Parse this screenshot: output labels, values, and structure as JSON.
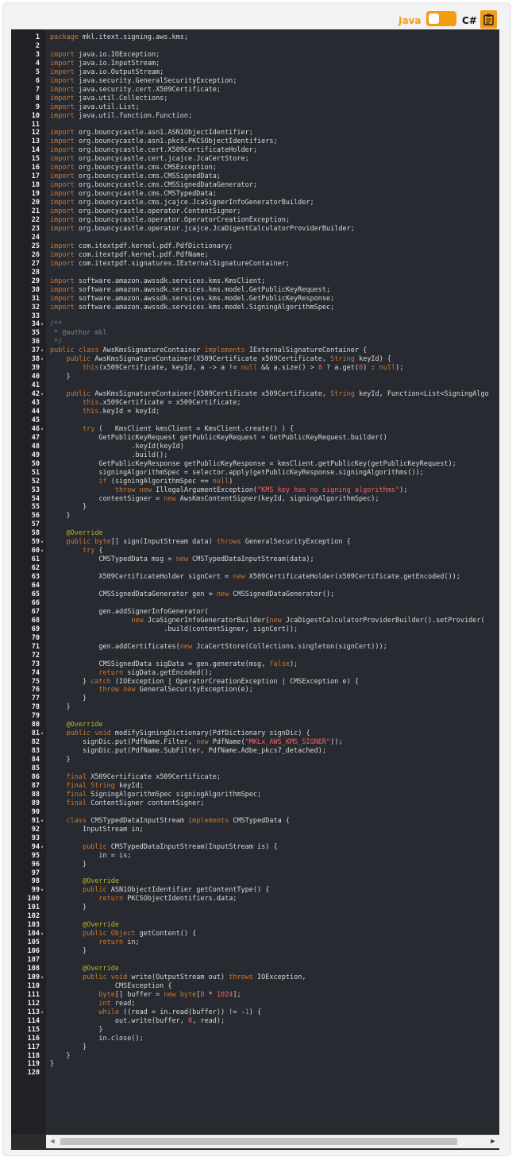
{
  "toolbar": {
    "java_label": "Java",
    "csharp_label": "C#",
    "copy_icon": "clipboard-icon",
    "toggle_state": "java",
    "accent": "#f39c12"
  },
  "code_lines": [
    "package mkl.itext.signing.aws.kms;",
    "",
    "import java.io.IOException;",
    "import java.io.InputStream;",
    "import java.io.OutputStream;",
    "import java.security.GeneralSecurityException;",
    "import java.security.cert.X509Certificate;",
    "import java.util.Collections;",
    "import java.util.List;",
    "import java.util.function.Function;",
    "",
    "import org.bouncycastle.asn1.ASN1ObjectIdentifier;",
    "import org.bouncycastle.asn1.pkcs.PKCSObjectIdentifiers;",
    "import org.bouncycastle.cert.X509CertificateHolder;",
    "import org.bouncycastle.cert.jcajce.JcaCertStore;",
    "import org.bouncycastle.cms.CMSException;",
    "import org.bouncycastle.cms.CMSSignedData;",
    "import org.bouncycastle.cms.CMSSignedDataGenerator;",
    "import org.bouncycastle.cms.CMSTypedData;",
    "import org.bouncycastle.cms.jcajce.JcaSignerInfoGeneratorBuilder;",
    "import org.bouncycastle.operator.ContentSigner;",
    "import org.bouncycastle.operator.OperatorCreationException;",
    "import org.bouncycastle.operator.jcajce.JcaDigestCalculatorProviderBuilder;",
    "",
    "import com.itextpdf.kernel.pdf.PdfDictionary;",
    "import com.itextpdf.kernel.pdf.PdfName;",
    "import com.itextpdf.signatures.IExternalSignatureContainer;",
    "",
    "import software.amazon.awssdk.services.kms.KmsClient;",
    "import software.amazon.awssdk.services.kms.model.GetPublicKeyRequest;",
    "import software.amazon.awssdk.services.kms.model.GetPublicKeyResponse;",
    "import software.amazon.awssdk.services.kms.model.SigningAlgorithmSpec;",
    "",
    "/**",
    " * @author mkl",
    " */",
    "public class AwsKmsSignatureContainer implements IExternalSignatureContainer {",
    "    public AwsKmsSignatureContainer(X509Certificate x509Certificate, String keyId) {",
    "        this(x509Certificate, keyId, a -> a != null && a.size() > 0 ? a.get(0) : null);",
    "    }",
    "",
    "    public AwsKmsSignatureContainer(X509Certificate x509Certificate, String keyId, Function<List<SigningAlgo",
    "        this.x509Certificate = x509Certificate;",
    "        this.keyId = keyId;",
    "",
    "        try (   KmsClient kmsClient = KmsClient.create() ) {",
    "            GetPublicKeyRequest getPublicKeyRequest = GetPublicKeyRequest.builder()",
    "                    .keyId(keyId)",
    "                    .build();",
    "            GetPublicKeyResponse getPublicKeyResponse = kmsClient.getPublicKey(getPublicKeyRequest);",
    "            signingAlgorithmSpec = selector.apply(getPublicKeyResponse.signingAlgorithms());",
    "            if (signingAlgorithmSpec == null)",
    "                throw new IllegalArgumentException(\"KMS key has no signing algorithms\");",
    "            contentSigner = new AwsKmsContentSigner(keyId, signingAlgorithmSpec);",
    "        }",
    "    }",
    "",
    "    @Override",
    "    public byte[] sign(InputStream data) throws GeneralSecurityException {",
    "        try {",
    "            CMSTypedData msg = new CMSTypedDataInputStream(data);",
    "",
    "            X509CertificateHolder signCert = new X509CertificateHolder(x509Certificate.getEncoded());",
    "",
    "            CMSSignedDataGenerator gen = new CMSSignedDataGenerator();",
    "",
    "            gen.addSignerInfoGenerator(",
    "                    new JcaSignerInfoGeneratorBuilder(new JcaDigestCalculatorProviderBuilder().setProvider(\"",
    "                            .build(contentSigner, signCert));",
    "",
    "            gen.addCertificates(new JcaCertStore(Collections.singleton(signCert)));",
    "",
    "            CMSSignedData sigData = gen.generate(msg, false);",
    "            return sigData.getEncoded();",
    "        } catch (IOException | OperatorCreationException | CMSException e) {",
    "            throw new GeneralSecurityException(e);",
    "        }",
    "    }",
    "",
    "    @Override",
    "    public void modifySigningDictionary(PdfDictionary signDic) {",
    "        signDic.put(PdfName.Filter, new PdfName(\"MKLx_AWS_KMS_SIGNER\"));",
    "        signDic.put(PdfName.SubFilter, PdfName.Adbe_pkcs7_detached);",
    "    }",
    "",
    "    final X509Certificate x509Certificate;",
    "    final String keyId;",
    "    final SigningAlgorithmSpec signingAlgorithmSpec;",
    "    final ContentSigner contentSigner;",
    "",
    "    class CMSTypedDataInputStream implements CMSTypedData {",
    "        InputStream in;",
    "",
    "        public CMSTypedDataInputStream(InputStream is) {",
    "            in = is;",
    "        }",
    "",
    "        @Override",
    "        public ASN1ObjectIdentifier getContentType() {",
    "            return PKCSObjectIdentifiers.data;",
    "        }",
    "",
    "        @Override",
    "        public Object getContent() {",
    "            return in;",
    "        }",
    "",
    "        @Override",
    "        public void write(OutputStream out) throws IOException,",
    "                CMSException {",
    "            byte[] buffer = new byte[8 * 1024];",
    "            int read;",
    "            while ((read = in.read(buffer)) != -1) {",
    "                out.write(buffer, 0, read);",
    "            }",
    "            in.close();",
    "        }",
    "    }",
    "}",
    ""
  ],
  "fold_lines": [
    34,
    37,
    38,
    42,
    46,
    59,
    60,
    81,
    91,
    94,
    99,
    104,
    109,
    113
  ],
  "syntax_colors": {
    "keyword": "#cc7832",
    "string": "#ff5f5f",
    "number": "#ff5f5f",
    "comment": "#808080",
    "annotation": "#bbb529",
    "default": "#d8d8d8",
    "line_number": "#f0f0f0"
  }
}
